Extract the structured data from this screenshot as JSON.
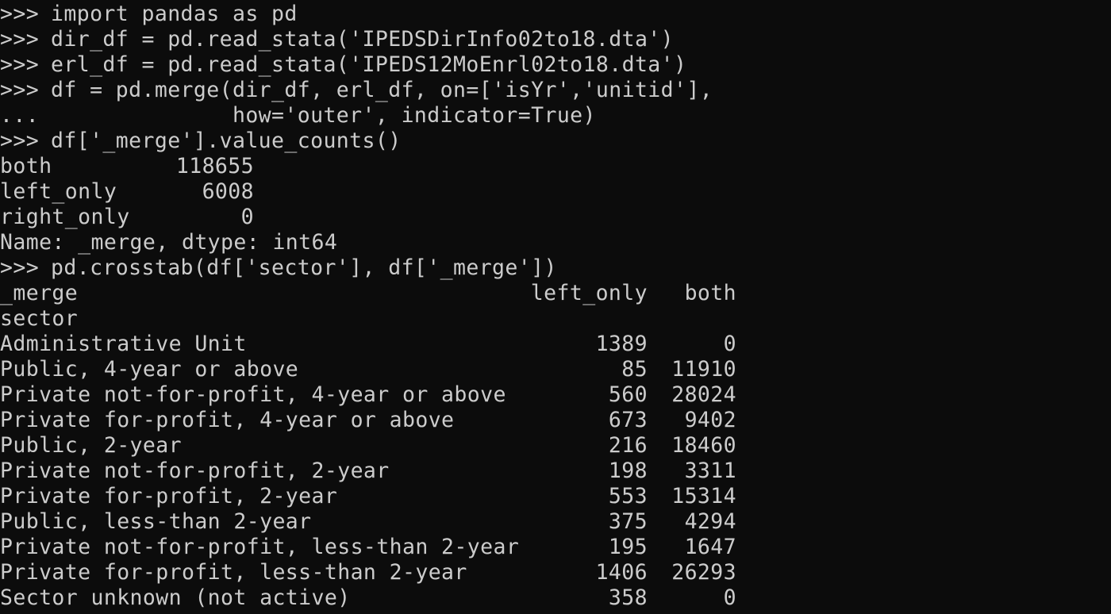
{
  "terminal": {
    "colors": {
      "background": "#0c0c0c",
      "foreground": "#cccccc"
    },
    "commands": [
      {
        "prompt": ">>>",
        "text": "import pandas as pd"
      },
      {
        "prompt": ">>>",
        "text": "dir_df = pd.read_stata('IPEDSDirInfo02to18.dta')"
      },
      {
        "prompt": ">>>",
        "text": "erl_df = pd.read_stata('IPEDS12MoEnrl02to18.dta')"
      },
      {
        "prompt": ">>>",
        "text": "df = pd.merge(dir_df, erl_df, on=['isYr','unitid'],"
      },
      {
        "prompt": "...",
        "text": "              how='outer', indicator=True)"
      },
      {
        "prompt": ">>>",
        "text": "df['_merge'].value_counts()"
      }
    ],
    "value_counts": {
      "rows": [
        {
          "label": "both",
          "value": "118655"
        },
        {
          "label": "left_only",
          "value": "6008"
        },
        {
          "label": "right_only",
          "value": "0"
        }
      ],
      "footer": "Name: _merge, dtype: int64"
    },
    "crosstab_command": {
      "prompt": ">>>",
      "text": "pd.crosstab(df['sector'], df['_merge'])"
    },
    "crosstab": {
      "columns_name": "_merge",
      "index_name": "sector",
      "columns": [
        "left_only",
        "both"
      ],
      "rows": [
        {
          "sector": "Administrative Unit",
          "left_only": "1389",
          "both": "0"
        },
        {
          "sector": "Public, 4-year or above",
          "left_only": "85",
          "both": "11910"
        },
        {
          "sector": "Private not-for-profit, 4-year or above",
          "left_only": "560",
          "both": "28024"
        },
        {
          "sector": "Private for-profit, 4-year or above",
          "left_only": "673",
          "both": "9402"
        },
        {
          "sector": "Public, 2-year",
          "left_only": "216",
          "both": "18460"
        },
        {
          "sector": "Private not-for-profit, 2-year",
          "left_only": "198",
          "both": "3311"
        },
        {
          "sector": "Private for-profit, 2-year",
          "left_only": "553",
          "both": "15314"
        },
        {
          "sector": "Public, less-than 2-year",
          "left_only": "375",
          "both": "4294"
        },
        {
          "sector": "Private not-for-profit, less-than 2-year",
          "left_only": "195",
          "both": "1647"
        },
        {
          "sector": "Private for-profit, less-than 2-year",
          "left_only": "1406",
          "both": "26293"
        },
        {
          "sector": "Sector unknown (not active)",
          "left_only": "358",
          "both": "0"
        }
      ]
    }
  }
}
